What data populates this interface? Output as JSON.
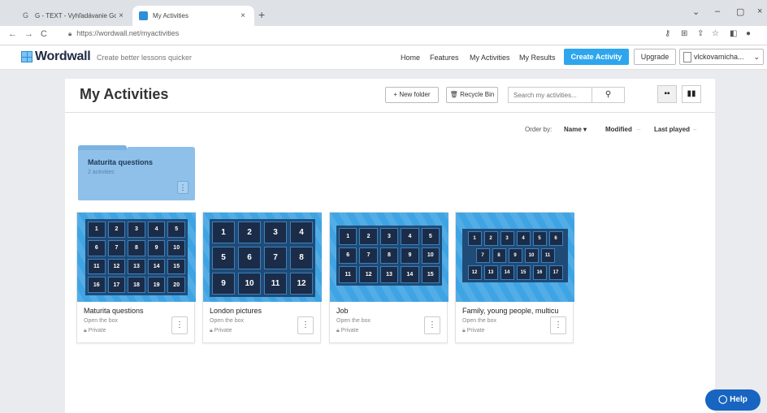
{
  "browser": {
    "tabs": [
      {
        "title": "G - TEXT - Vyhľadávanie Goo",
        "close": "×",
        "icon": "google-icon"
      },
      {
        "title": "My Activities",
        "close": "×",
        "icon": "wordwall-icon"
      }
    ],
    "new_tab": "+",
    "url": "https://wordwall.net/myactivities",
    "nav": {
      "back": "←",
      "forward": "→",
      "reload": "C"
    }
  },
  "site": {
    "logo": "Wordwall",
    "tagline": "Create better lessons quicker",
    "nav": [
      "Home",
      "Features",
      "My Activities",
      "My Results"
    ],
    "create_activity": "Create Activity",
    "upgrade": "Upgrade",
    "user": "vlckovamicha..."
  },
  "page": {
    "title": "My Activities",
    "new_folder": "New folder",
    "recycle_bin": "Recycle Bin",
    "search_placeholder": "Search my activities...",
    "order_by": "Order by:",
    "order_name": "Name ▾",
    "order_modified": "Modified",
    "order_last_played": "Last played",
    "dash1": "–",
    "dash2": "–"
  },
  "folder": {
    "name": "Maturita questions",
    "count": "2 activities",
    "menu": "⋮"
  },
  "activities": [
    {
      "title": "Maturita questions",
      "template": "Open the box",
      "privacy": "Private",
      "tiles": [
        "1",
        "2",
        "3",
        "4",
        "5",
        "6",
        "7",
        "8",
        "9",
        "10",
        "11",
        "12",
        "13",
        "14",
        "15",
        "16",
        "17",
        "18",
        "19",
        "20"
      ]
    },
    {
      "title": "London pictures",
      "template": "Open the box",
      "privacy": "Private",
      "tiles": [
        "1",
        "2",
        "3",
        "4",
        "5",
        "6",
        "7",
        "8",
        "9",
        "10",
        "11",
        "12"
      ]
    },
    {
      "title": "Job",
      "template": "Open the box",
      "privacy": "Private",
      "tiles": [
        "1",
        "2",
        "3",
        "4",
        "5",
        "6",
        "7",
        "8",
        "9",
        "10",
        "11",
        "12",
        "13",
        "14",
        "15"
      ]
    },
    {
      "title": "Family, young people, multicu",
      "template": "Open the box",
      "privacy": "Private",
      "tiles": [
        "1",
        "2",
        "3",
        "4",
        "5",
        "6",
        "7",
        "8",
        "9",
        "10",
        "11",
        "12",
        "13",
        "14",
        "15",
        "16",
        "17"
      ]
    }
  ],
  "help": "Help",
  "colors": {
    "accent": "#2ea6ee",
    "help": "#1765c1",
    "thumb_bg": "#3fa4e3",
    "tile": "#1a2c48",
    "folder": "#8ec0ea"
  }
}
